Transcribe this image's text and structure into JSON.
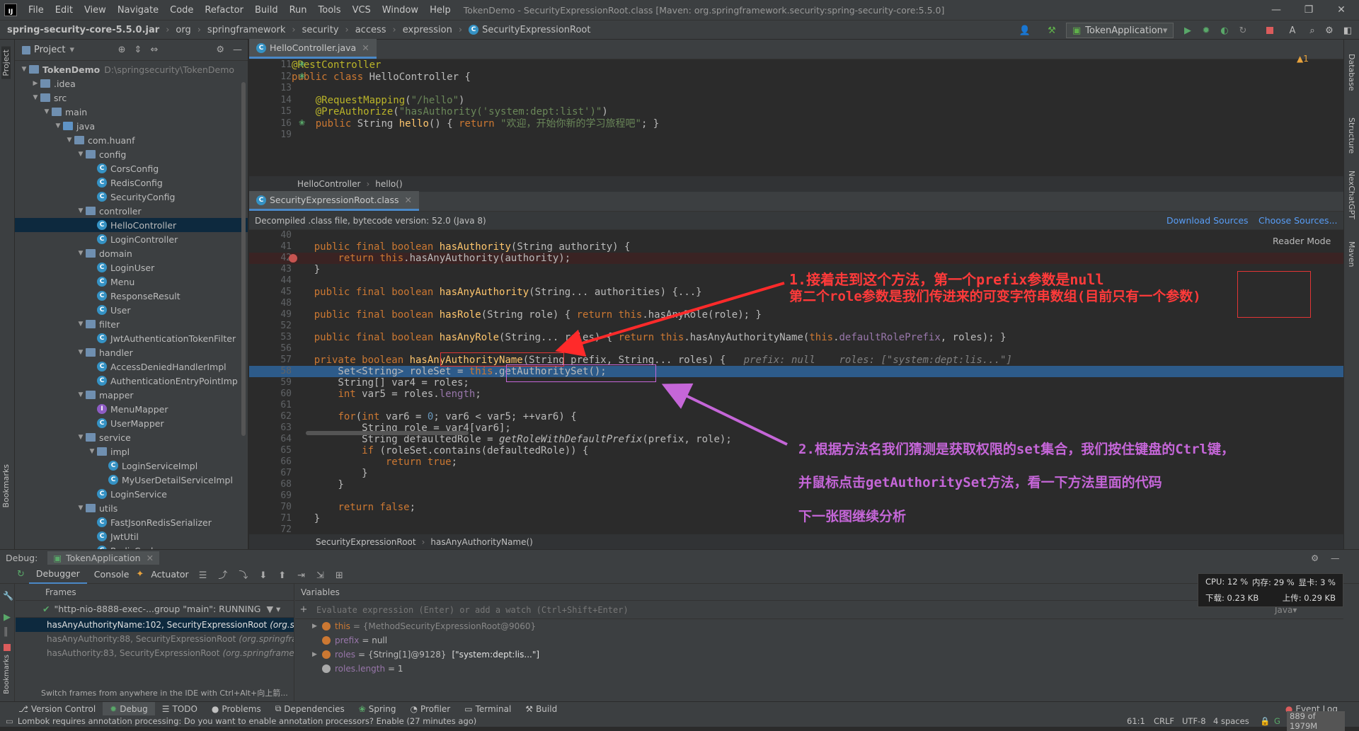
{
  "menubar": {
    "items": [
      "File",
      "Edit",
      "View",
      "Navigate",
      "Code",
      "Refactor",
      "Build",
      "Run",
      "Tools",
      "VCS",
      "Window",
      "Help"
    ],
    "title": "TokenDemo - SecurityExpressionRoot.class [Maven: org.springframework.security:spring-security-core:5.5.0]"
  },
  "navbar": {
    "crumbs": [
      "spring-security-core-5.5.0.jar",
      "org",
      "springframework",
      "security",
      "access",
      "expression",
      "SecurityExpressionRoot"
    ],
    "run_config": "TokenApplication"
  },
  "project": {
    "title": "Project",
    "tree": [
      {
        "label": "TokenDemo",
        "extra": "D:\\springsecurity\\TokenDemo",
        "depth": 0,
        "kind": "module",
        "open": true
      },
      {
        "label": ".idea",
        "depth": 1,
        "kind": "folder",
        "open": false
      },
      {
        "label": "src",
        "depth": 1,
        "kind": "folder",
        "open": true
      },
      {
        "label": "main",
        "depth": 2,
        "kind": "folder",
        "open": true
      },
      {
        "label": "java",
        "depth": 3,
        "kind": "src",
        "open": true
      },
      {
        "label": "com.huanf",
        "depth": 4,
        "kind": "folder",
        "open": true
      },
      {
        "label": "config",
        "depth": 5,
        "kind": "folder",
        "open": true
      },
      {
        "label": "CorsConfig",
        "depth": 6,
        "kind": "class"
      },
      {
        "label": "RedisConfig",
        "depth": 6,
        "kind": "class"
      },
      {
        "label": "SecurityConfig",
        "depth": 6,
        "kind": "class"
      },
      {
        "label": "controller",
        "depth": 5,
        "kind": "folder",
        "open": true
      },
      {
        "label": "HelloController",
        "depth": 6,
        "kind": "class",
        "selected": true
      },
      {
        "label": "LoginController",
        "depth": 6,
        "kind": "class"
      },
      {
        "label": "domain",
        "depth": 5,
        "kind": "folder",
        "open": true
      },
      {
        "label": "LoginUser",
        "depth": 6,
        "kind": "class"
      },
      {
        "label": "Menu",
        "depth": 6,
        "kind": "class"
      },
      {
        "label": "ResponseResult",
        "depth": 6,
        "kind": "class"
      },
      {
        "label": "User",
        "depth": 6,
        "kind": "class"
      },
      {
        "label": "filter",
        "depth": 5,
        "kind": "folder",
        "open": true
      },
      {
        "label": "JwtAuthenticationTokenFilter",
        "depth": 6,
        "kind": "class"
      },
      {
        "label": "handler",
        "depth": 5,
        "kind": "folder",
        "open": true
      },
      {
        "label": "AccessDeniedHandlerImpl",
        "depth": 6,
        "kind": "class"
      },
      {
        "label": "AuthenticationEntryPointImp",
        "depth": 6,
        "kind": "class"
      },
      {
        "label": "mapper",
        "depth": 5,
        "kind": "folder",
        "open": true
      },
      {
        "label": "MenuMapper",
        "depth": 6,
        "kind": "mapper"
      },
      {
        "label": "UserMapper",
        "depth": 6,
        "kind": "class"
      },
      {
        "label": "service",
        "depth": 5,
        "kind": "folder",
        "open": true
      },
      {
        "label": "impl",
        "depth": 6,
        "kind": "folder",
        "open": true
      },
      {
        "label": "LoginServiceImpl",
        "depth": 7,
        "kind": "class"
      },
      {
        "label": "MyUserDetailServiceImpl",
        "depth": 7,
        "kind": "class"
      },
      {
        "label": "LoginService",
        "depth": 6,
        "kind": "class"
      },
      {
        "label": "utils",
        "depth": 5,
        "kind": "folder",
        "open": true
      },
      {
        "label": "FastJsonRedisSerializer",
        "depth": 6,
        "kind": "class"
      },
      {
        "label": "JwtUtil",
        "depth": 6,
        "kind": "class"
      },
      {
        "label": "RedisCache",
        "depth": 6,
        "kind": "class"
      }
    ]
  },
  "editor1": {
    "tab": "HelloController.java",
    "warning": "▲1",
    "lines": [
      {
        "n": "11",
        "html": "<span class='an'>@RestController</span>"
      },
      {
        "n": "12",
        "html": "<span class='kw'>public class </span>HelloController {"
      },
      {
        "n": "13",
        "html": ""
      },
      {
        "n": "14",
        "html": "    <span class='an'>@RequestMapping</span>(<span class='st'>\"/hello\"</span>)"
      },
      {
        "n": "15",
        "html": "    <span class='an'>@PreAuthorize</span>(<span class='st'>\"hasAuthority('system:dept:list')\"</span>)"
      },
      {
        "n": "16",
        "html": "    <span class='kw'>public </span>String <span class='fn'>hello</span>() { <span class='kw'>return </span><span class='st'>\"欢迎，开始你新的学习旅程吧\"</span>; }"
      },
      {
        "n": "19",
        "html": ""
      }
    ],
    "breadcrumb": [
      "HelloController",
      "hello()"
    ]
  },
  "editor2": {
    "tab": "SecurityExpressionRoot.class",
    "decompiled": "Decompiled .class file, bytecode version: 52.0 (Java 8)",
    "download": "Download Sources",
    "choose": "Choose Sources...",
    "reader": "Reader Mode",
    "lines": [
      {
        "n": "40",
        "html": ""
      },
      {
        "n": "41",
        "html": "    <span class='kw'>public final boolean </span><span class='fn'>hasAuthority</span>(String authority) {"
      },
      {
        "n": "42",
        "html": "        <span class='kw'>return this</span>.hasAnyAuthority(authority);"
      },
      {
        "n": "43",
        "html": "    }"
      },
      {
        "n": "44",
        "html": ""
      },
      {
        "n": "45",
        "html": "    <span class='kw'>public final boolean </span><span class='fn'>hasAnyAuthority</span>(String... authorities) {...}"
      },
      {
        "n": "48",
        "html": ""
      },
      {
        "n": "49",
        "html": "    <span class='kw'>public final boolean </span><span class='fn'>hasRole</span>(String role) { <span class='kw'>return this</span>.hasAnyRole(role); }"
      },
      {
        "n": "52",
        "html": ""
      },
      {
        "n": "53",
        "html": "    <span class='kw'>public final boolean </span><span class='fn'>hasAnyRole</span>(String... roles) { <span class='kw'>return this</span>.hasAnyAuthorityName(<span class='kw'>this</span>.<span class='fld'>defaultRolePrefix</span>, roles); }"
      },
      {
        "n": "56",
        "html": ""
      },
      {
        "n": "57",
        "html": "    <span class='kw'>private boolean </span><span class='fn'>hasAnyAuthorityName</span>(String prefix, String... roles) {   <span class='gr'>prefix: null    roles: [\"system:dept:lis...\"]</span>"
      },
      {
        "n": "58",
        "html": "        Set&lt;String&gt; roleSet = <span class='kw'>this</span>.getAuthoritySet();"
      },
      {
        "n": "59",
        "html": "        String[] var4 = roles;"
      },
      {
        "n": "60",
        "html": "        <span class='kw'>int </span>var5 = roles.<span class='fld'>length</span>;"
      },
      {
        "n": "61",
        "html": ""
      },
      {
        "n": "62",
        "html": "        <span class='kw'>for</span>(<span class='kw'>int </span>var6 = <span class='nu'>0</span>; var6 &lt; var5; ++var6) {"
      },
      {
        "n": "63",
        "html": "            String role = var4[var6];"
      },
      {
        "n": "64",
        "html": "            String defaultedRole = <span style='font-style:italic'>getRoleWithDefaultPrefix</span>(prefix, role);"
      },
      {
        "n": "65",
        "html": "            <span class='kw'>if </span>(roleSet.contains(defaultedRole)) {"
      },
      {
        "n": "66",
        "html": "                <span class='kw'>return true</span>;"
      },
      {
        "n": "67",
        "html": "            }"
      },
      {
        "n": "68",
        "html": "        }"
      },
      {
        "n": "69",
        "html": ""
      },
      {
        "n": "70",
        "html": "        <span class='kw'>return false</span>;"
      },
      {
        "n": "71",
        "html": "    }"
      },
      {
        "n": "72",
        "html": ""
      }
    ],
    "breadcrumb": [
      "SecurityExpressionRoot",
      "hasAnyAuthorityName()"
    ]
  },
  "annotations": {
    "a1_line1": "1.接着走到这个方法，第一个prefix参数是null",
    "a1_line2": "第二个role参数是我们传进来的可变字符串数组(目前只有一个参数)",
    "a2_line1": "2.根据方法名我们猜测是获取权限的set集合，我们按住键盘的Ctrl键，",
    "a2_line2": "并鼠标点击getAuthoritySet方法，看一下方法里面的代码",
    "a2_line3": "下一张图继续分析"
  },
  "debug": {
    "label": "Debug:",
    "session": "TokenApplication",
    "tabs": [
      "Debugger",
      "Console",
      "Actuator"
    ],
    "frames_title": "Frames",
    "thread": "\"http-nio-8888-exec-...group \"main\": RUNNING",
    "frames": [
      {
        "method": "hasAnyAuthorityName:102, SecurityExpressionRoot",
        "pkg": "(org.spr"
      },
      {
        "method": "hasAnyAuthority:88, SecurityExpressionRoot",
        "pkg": "(org.springfram"
      },
      {
        "method": "hasAuthority:83, SecurityExpressionRoot",
        "pkg": "(org.springframew"
      }
    ],
    "frames_hint": "Switch frames from anywhere in the IDE with Ctrl+Alt+向上箭...",
    "variables_title": "Variables",
    "eval_placeholder": "Evaluate expression (Enter) or add a watch (Ctrl+Shift+Enter)",
    "lang": "Java▾",
    "vars": [
      {
        "name": "this",
        "value": "= {MethodSecurityExpressionRoot@9060}"
      },
      {
        "name": "prefix",
        "value": "= null"
      },
      {
        "name": "roles",
        "value": "= {String[1]@9128}",
        "extra": "[\"system:dept:lis...\"]"
      },
      {
        "name": "roles.length",
        "value": "= 1"
      }
    ]
  },
  "cpu": {
    "cpu": "CPU: 12 %",
    "mem": "内存: 29 %",
    "gpu": "显卡: 3 %",
    "down": "下载: 0.23 KB",
    "up": "上传: 0.29 KB"
  },
  "toolwindows": [
    "Version Control",
    "Debug",
    "TODO",
    "Problems",
    "Dependencies",
    "Spring",
    "Profiler",
    "Terminal",
    "Build"
  ],
  "event_log": "Event Log",
  "status": {
    "message": "Lombok requires annotation processing: Do you want to enable annotation processors? Enable (27 minutes ago)",
    "pos": "61:1",
    "crlf": "CRLF",
    "enc": "UTF-8",
    "indent": "4 spaces",
    "mem": "889 of 1979M"
  },
  "side": {
    "left": [
      "Project",
      "Bookmarks"
    ],
    "right": [
      "Database",
      "Structure",
      "NexChatGPT",
      "Maven"
    ]
  }
}
